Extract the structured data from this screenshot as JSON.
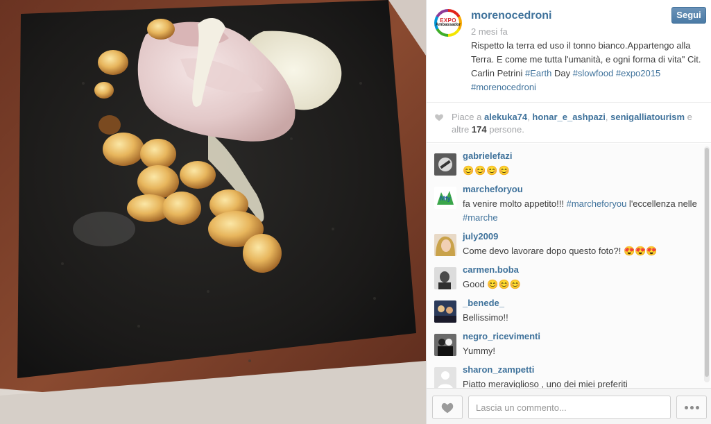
{
  "post": {
    "username": "morenocedroni",
    "timestamp": "2 mesi fa",
    "follow_label": "Segui",
    "avatar_text": "Ambassador",
    "avatar_brand": "EXPO",
    "caption_parts": {
      "text_1": "Rispetto la terra ed uso il tonno bianco.Appartengo alla Terra. E come me tutta l'umanità, e ogni forma di vita\" Cit. Carlin Petrini ",
      "tag_earth": "#Earth",
      "text_2": " Day ",
      "tag_slowfood": "#slowfood",
      "text_3": " ",
      "tag_expo": "#expo2015",
      "text_4": " ",
      "tag_moreno": "#morenocedroni"
    }
  },
  "likes": {
    "prefix": "Piace a ",
    "user_1": "alekuka74",
    "sep_1": ", ",
    "user_2": "honar_e_ashpazi",
    "sep_2": ", ",
    "user_3": "senigalliatourism",
    "middle": " e altre ",
    "count": "174",
    "suffix": " persone."
  },
  "comments": [
    {
      "username": "gabrielefazi",
      "text": "😊😊😊😊"
    },
    {
      "username": "marcheforyou",
      "text_1": "fa venire molto appetito!!! ",
      "tag_1": "#marcheforyou",
      "text_2": " l'eccellenza nelle ",
      "tag_2": "#marche"
    },
    {
      "username": "july2009",
      "text": "Come devo lavorare dopo questo foto?! 😍😍😍"
    },
    {
      "username": "carmen.boba",
      "text": "Good 😊😊😊"
    },
    {
      "username": "_benede_",
      "text": "Bellissimo!!"
    },
    {
      "username": "negro_ricevimenti",
      "text": "Yummy!"
    },
    {
      "username": "sharon_zampetti",
      "text": "Piatto meraviglioso , uno dei miei preferiti"
    }
  ],
  "footer": {
    "comment_placeholder": "Lascia un commento..."
  },
  "colors": {
    "link": "#3f729b",
    "follow_button": "#4a7aa5",
    "muted": "#a5a7aa"
  }
}
